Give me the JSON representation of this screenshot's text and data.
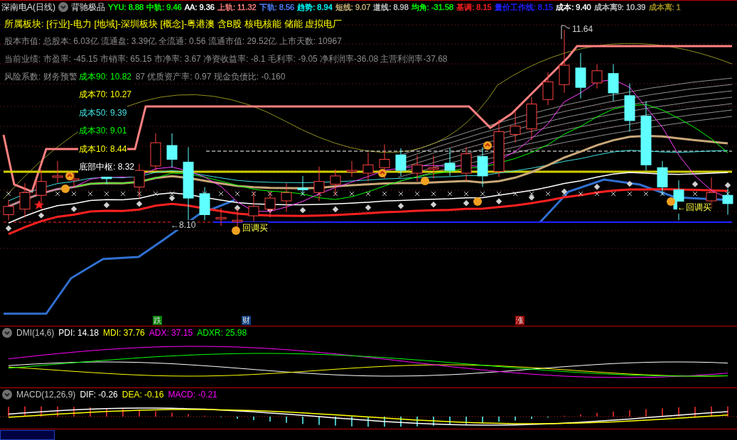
{
  "header": {
    "title": "深南电A(日线)",
    "indicator_name": "背驰极品",
    "values": [
      {
        "text": "YYU: 8.88",
        "color": "#00ff00"
      },
      {
        "text": "中轨: 9.46",
        "color": "#00ff00"
      },
      {
        "text": "AA: 9.36",
        "color": "#ffffff"
      },
      {
        "text": "上轨: 11.32",
        "color": "#ff8080"
      },
      {
        "text": "下轨: 8.56",
        "color": "#5080ff"
      },
      {
        "text": "趋势: 8.94",
        "color": "#00ffff"
      },
      {
        "text": "短线: 9.07",
        "color": "#c8b078"
      },
      {
        "text": "道线: 8.98",
        "color": "#c0c0c0"
      },
      {
        "text": "均角: -31.58",
        "color": "#00ff00"
      },
      {
        "text": "基调: 8.15",
        "color": "#ff2020"
      },
      {
        "text": "量价工作线: 8.15",
        "color": "#2020ff"
      },
      {
        "text": "成本: 9.40",
        "color": "#ffffff"
      },
      {
        "text": "成本离9: 10.39",
        "color": "#c0c0c0"
      },
      {
        "text": "成本离: 1",
        "color": "#a09020"
      }
    ]
  },
  "sector_line": "所属板块: [行业]-电力 [地域]-深圳板块 [概念]-粤港澳 含B股 核电核能 储能 虚拟电厂",
  "info_lines": [
    "股本市值: 总股本: 6.03亿 流通盘: 3.39亿 全流通: 0.56 流通市值: 29.52亿 上市天数: 10967",
    "当前业绩: 市盈率: -45.15 市销率: 65.15 市净率: 3.67 净资收益率: -8.1 毛利率: -9.05 净利润率-36.08 主营利润率-37.68"
  ],
  "risk_line": {
    "prefix": "风险系数: 财务预警",
    "suffix": "87 优质资产率: 0.97 现金负债比: -0.160"
  },
  "cost_levels": [
    {
      "text": "成本90: 10.82",
      "color": "#00ff00"
    },
    {
      "text": "成本70: 10.27",
      "color": "#ffff00"
    },
    {
      "text": "成本50: 9.39",
      "color": "#40e0e0"
    },
    {
      "text": "成本30: 9.01",
      "color": "#00ff00"
    },
    {
      "text": "成本10: 8.44",
      "color": "#ffff00"
    },
    {
      "text": "底部中枢: 8.32",
      "color": "#ffffff"
    }
  ],
  "price_labels": {
    "high": "11.64",
    "low": "←8.10"
  },
  "signals": [
    "回调买",
    "←回调买"
  ],
  "markers": [
    {
      "text": "跌",
      "color": "#008000"
    },
    {
      "text": "财",
      "color": "#104080"
    },
    {
      "text": "涨",
      "color": "#a00000"
    }
  ],
  "dmi": {
    "title": "DMI(14,6)",
    "values": [
      {
        "text": "PDI: 14.18",
        "color": "#ffffff"
      },
      {
        "text": "MDI: 37.76",
        "color": "#ffff00"
      },
      {
        "text": "ADX: 37.15",
        "color": "#ff00ff"
      },
      {
        "text": "ADXR: 25.98",
        "color": "#00ff00"
      }
    ]
  },
  "macd": {
    "title": "MACD(12,26,9)",
    "values": [
      {
        "text": "DIF: -0.26",
        "color": "#ffffff"
      },
      {
        "text": "DEA: -0.16",
        "color": "#ffff00"
      },
      {
        "text": "MACD: -0.21",
        "color": "#ff00ff"
      }
    ]
  }
}
